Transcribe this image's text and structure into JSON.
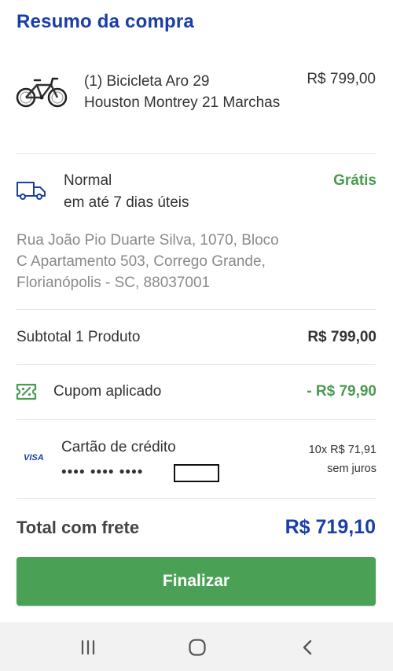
{
  "page": {
    "title": "Resumo da compra"
  },
  "product": {
    "name_line1": "(1) Bicicleta Aro 29",
    "name_line2": "Houston Montrey 21 Marchas",
    "price": "R$ 799,00",
    "icon": "bicycle-icon"
  },
  "shipping": {
    "type": "Normal",
    "eta": "em até 7 dias úteis",
    "price": "Grátis",
    "icon": "truck-icon",
    "address_line1": "Rua João Pio Duarte Silva, 1070, Bloco",
    "address_line2": "C Apartamento 503, Corrego Grande,",
    "address_line3": "Florianópolis - SC, 88037001"
  },
  "subtotal": {
    "label": "Subtotal 1 Produto",
    "value": "R$ 799,00"
  },
  "coupon": {
    "label": "Cupom aplicado",
    "value": "- R$ 79,90",
    "icon": "coupon-icon"
  },
  "payment": {
    "brand": "VISA",
    "method": "Cartão de crédito",
    "masked_number": "•••• •••• ••••",
    "installments": "10x R$ 71,91",
    "interest": "sem juros"
  },
  "total": {
    "label": "Total com frete",
    "value": "R$ 719,10"
  },
  "actions": {
    "finish_label": "Finalizar"
  },
  "navbar": {
    "recent_icon": "recent-apps-icon",
    "home_icon": "home-icon",
    "back_icon": "back-icon"
  },
  "colors": {
    "brand_blue": "#1a3ea8",
    "success_green": "#4a9a52",
    "button_green": "#4aa155",
    "muted_text": "#8a8a8a"
  }
}
